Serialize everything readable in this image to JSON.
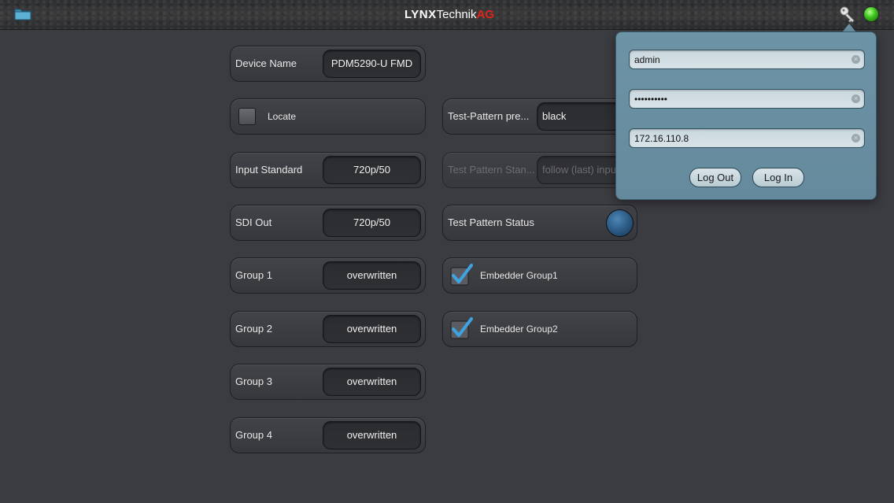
{
  "header": {
    "logo_lynx": "LYNX",
    "logo_technik": "Technik",
    "logo_ag": "AG"
  },
  "controls": {
    "device_name": {
      "label": "Device Name",
      "value": "PDM5290-U FMD"
    },
    "locate": {
      "label": "Locate",
      "checked": false
    },
    "input_standard": {
      "label": "Input Standard",
      "value": "720p/50"
    },
    "sdi_out": {
      "label": "SDI Out",
      "value": "720p/50"
    },
    "group1": {
      "label": "Group 1",
      "value": "overwritten"
    },
    "group2": {
      "label": "Group 2",
      "value": "overwritten"
    },
    "group3": {
      "label": "Group 3",
      "value": "overwritten"
    },
    "group4": {
      "label": "Group 4",
      "value": "overwritten"
    },
    "test_pattern_preset": {
      "label": "Test-Pattern pre...",
      "value": "black"
    },
    "test_pattern_standard": {
      "label": "Test Pattern Stan...",
      "value": "follow (last) input"
    },
    "test_pattern_status": {
      "label": "Test Pattern Status"
    },
    "embedder_group1": {
      "label": "Embedder Group1",
      "checked": true
    },
    "embedder_group2": {
      "label": "Embedder Group2",
      "checked": true
    }
  },
  "login": {
    "username": "admin",
    "password": "••••••••••",
    "host": "172.16.110.8",
    "logout_label": "Log Out",
    "login_label": "Log In"
  },
  "colors": {
    "background": "#3b3c41",
    "popover": "#6d93a6",
    "status_led": "#39c21a",
    "logo_accent": "#e2231a",
    "status_ball": "#2c5b86"
  }
}
